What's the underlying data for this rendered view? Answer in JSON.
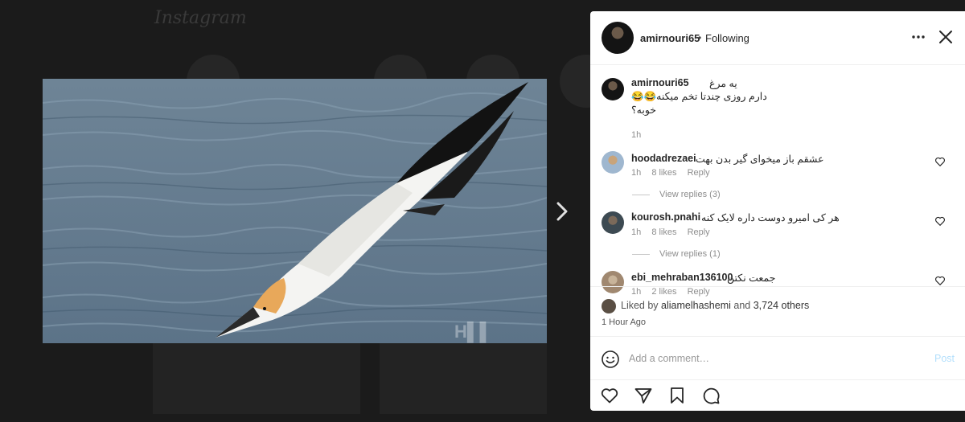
{
  "background": {
    "logo": "Instagram"
  },
  "post": {
    "author": "amirnouri65",
    "follow_separator": "•",
    "follow_status": "Following",
    "caption": {
      "username": "amirnouri65",
      "line1": "یه مرغ",
      "line2": "دارم روزی چندتا تخم میکنه😂😂",
      "line3": "خوبه؟",
      "time": "1h"
    },
    "comments": [
      {
        "username": "hoodadrezaei",
        "text": "عشقم باز میخوای گیر بدن بهت",
        "time": "1h",
        "likes": "8 likes",
        "reply": "Reply",
        "view_replies": "View replies (3)"
      },
      {
        "username": "kourosh.pnahi",
        "text": "هر کی امیرو دوست داره لایک کنه",
        "time": "1h",
        "likes": "8 likes",
        "reply": "Reply",
        "view_replies": "View replies (1)"
      },
      {
        "username": "ebi_mehraban136100",
        "text": "جمعت نکتن",
        "time": "1h",
        "likes": "2 likes",
        "reply": "Reply"
      }
    ],
    "likes": {
      "prefix": "Liked by",
      "user": "aliamelhashemi",
      "middle": "and",
      "count": "3,724 others"
    },
    "posted": "1 Hour Ago",
    "add_comment_placeholder": "Add a comment…",
    "post_button": "Post"
  },
  "icons": {
    "more": "more-options-icon",
    "close": "close-icon",
    "next": "chevron-right-icon",
    "like": "heart-icon",
    "share": "paper-plane-icon",
    "save": "bookmark-icon",
    "comment": "comment-bubble-icon",
    "emoji": "smiley-icon"
  }
}
